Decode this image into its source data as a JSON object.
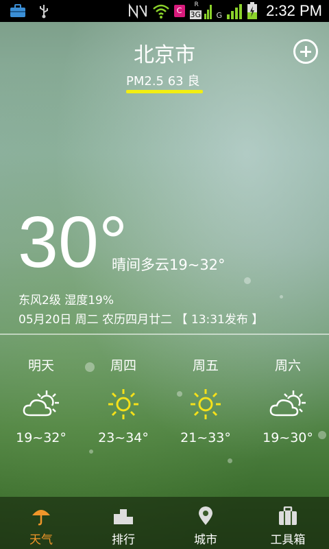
{
  "status_bar": {
    "time": "2:32 PM",
    "network_label": "3G",
    "roaming_label": "R",
    "carrier_letter": "G",
    "sim_badge": "C"
  },
  "header": {
    "city": "北京市",
    "aqi_text": "PM2.5 63 良",
    "aqi_bar_color": "#f2ee12"
  },
  "current": {
    "temperature": "30°",
    "condition": "晴间多云19~32°",
    "wind_humidity": "东风2级 湿度19%",
    "date_line": "05月20日 周二 农历四月廿二 【 13:31发布 】"
  },
  "forecast": [
    {
      "day": "明天",
      "icon": "partly-cloudy-icon",
      "range": "19~32°"
    },
    {
      "day": "周四",
      "icon": "sun-icon",
      "range": "23~34°"
    },
    {
      "day": "周五",
      "icon": "sun-icon",
      "range": "21~33°"
    },
    {
      "day": "周六",
      "icon": "partly-cloudy-icon",
      "range": "19~30°"
    }
  ],
  "tabs": [
    {
      "label": "天气",
      "icon": "umbrella-icon",
      "active": true,
      "color": "#f0962a"
    },
    {
      "label": "排行",
      "icon": "podium-icon",
      "active": false
    },
    {
      "label": "城市",
      "icon": "location-pin-icon",
      "active": false
    },
    {
      "label": "工具箱",
      "icon": "toolbox-icon",
      "active": false
    }
  ]
}
